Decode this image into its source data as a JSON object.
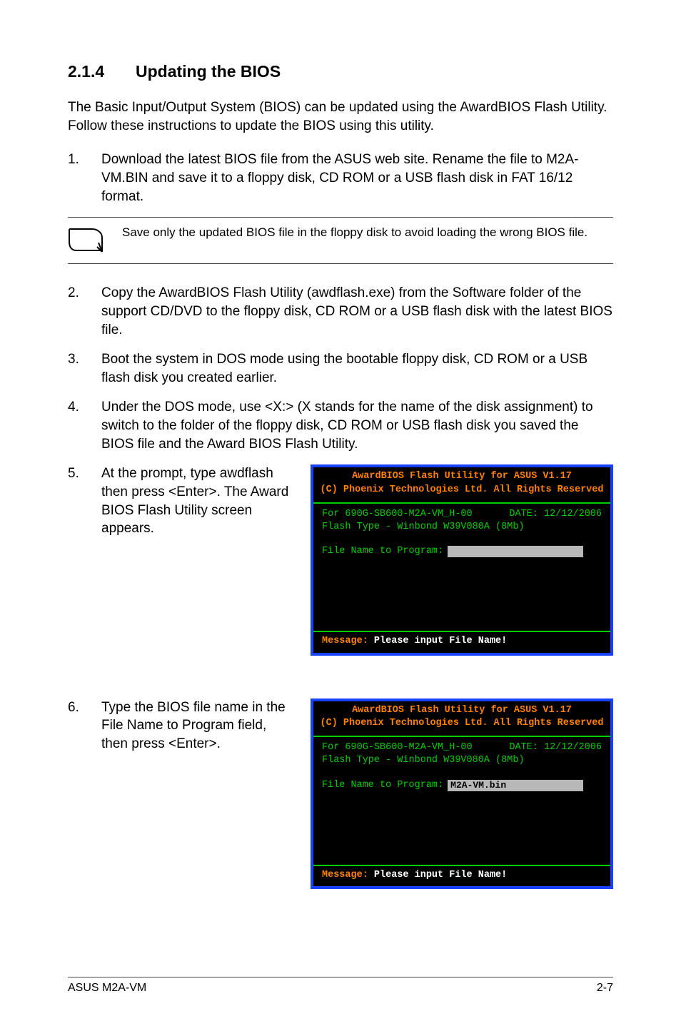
{
  "heading": {
    "number": "2.1.4",
    "title": "Updating the BIOS"
  },
  "intro": "The Basic Input/Output System (BIOS) can be updated using the AwardBIOS Flash Utility. Follow these instructions to update the BIOS using this utility.",
  "step1": {
    "num": "1.",
    "text": "Download the latest BIOS file from the ASUS web site. Rename the file to M2A-VM.BIN and save it to a floppy disk, CD ROM or a USB flash disk in FAT 16/12 format."
  },
  "note": "Save only the updated BIOS file in the floppy disk to avoid loading the wrong BIOS file.",
  "step2": {
    "num": "2.",
    "text": "Copy the AwardBIOS Flash Utility (awdflash.exe) from the Software folder of the support CD/DVD to the floppy disk, CD ROM or a USB flash disk with the latest BIOS file."
  },
  "step3": {
    "num": "3.",
    "text": "Boot the system in DOS mode using the bootable floppy disk, CD ROM or a USB flash disk you created earlier."
  },
  "step4": {
    "num": "4.",
    "text": "Under the DOS mode, use <X:> (X stands for the name of the disk assignment) to switch to the folder of the floppy disk, CD ROM or USB flash disk you saved the BIOS file and the Award BIOS Flash Utility."
  },
  "step5": {
    "num": "5.",
    "text": "At the prompt, type awdflash then press <Enter>. The Award BIOS Flash Utility screen appears."
  },
  "step6": {
    "num": "6.",
    "text": "Type the BIOS file name in the File Name to Program field, then press <Enter>."
  },
  "bios": {
    "header1": "AwardBIOS Flash Utility for ASUS V1.17",
    "header2": "(C) Phoenix Technologies Ltd. All Rights Reserved",
    "infoLeft": "For 690G-SB600-M2A-VM_H-00",
    "infoRight": "DATE: 12/12/2006",
    "flashType": "Flash Type - Winbond W39V080A (8Mb)",
    "promptLabel": "File Name to Program:",
    "filename": "M2A-VM.bin",
    "msgLabel": "Message:",
    "msgText": " Please input File Name!"
  },
  "footer": {
    "left": "ASUS M2A-VM",
    "right": "2-7"
  }
}
